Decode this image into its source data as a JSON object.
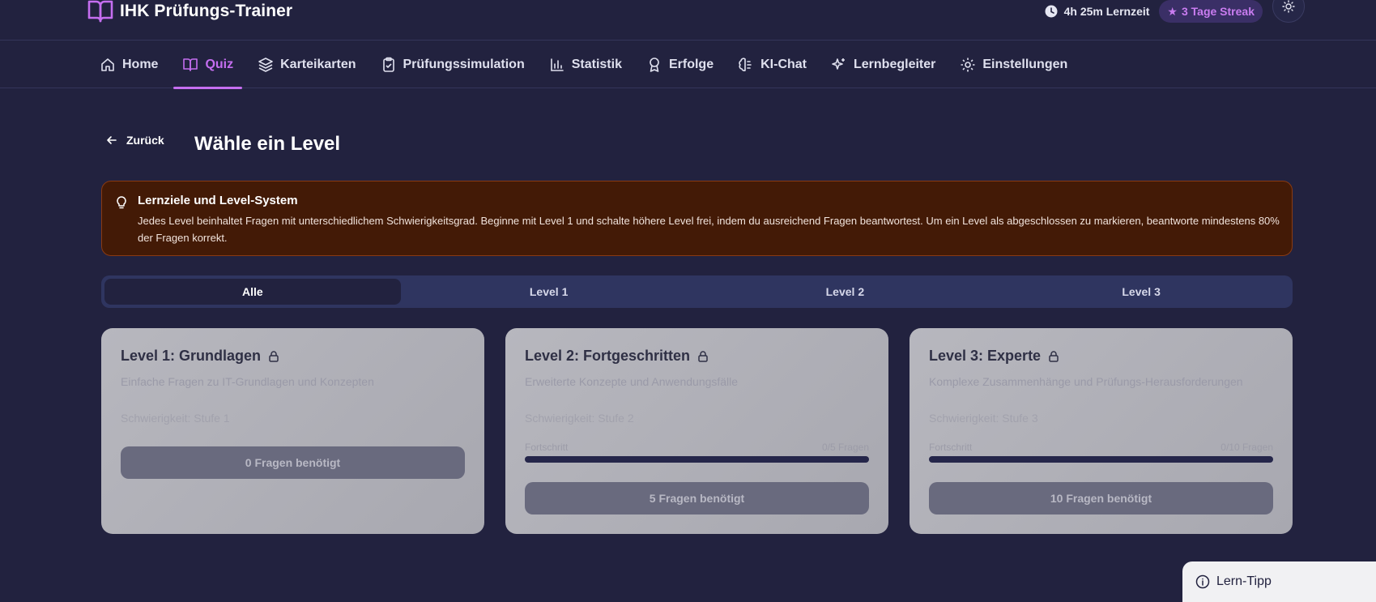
{
  "app": {
    "title": "IHK Prüfungs-Trainer",
    "learning_time": "4h 25m Lernzeit",
    "streak": "3 Tage Streak",
    "accent": "#c56ef0"
  },
  "nav": {
    "items": [
      {
        "label": "Home",
        "icon": "home-icon"
      },
      {
        "label": "Quiz",
        "icon": "book-open-icon",
        "active": true
      },
      {
        "label": "Karteikarten",
        "icon": "layers-icon"
      },
      {
        "label": "Prüfungssimulation",
        "icon": "clipboard-check-icon"
      },
      {
        "label": "Statistik",
        "icon": "bar-chart-icon"
      },
      {
        "label": "Erfolge",
        "icon": "award-icon"
      },
      {
        "label": "KI-Chat",
        "icon": "brain-icon"
      },
      {
        "label": "Lernbegleiter",
        "icon": "sparkles-icon"
      },
      {
        "label": "Einstellungen",
        "icon": "settings-icon"
      }
    ]
  },
  "page": {
    "back_label": "Zurück",
    "title": "Wähle ein Level"
  },
  "banner": {
    "title": "Lernziele und Level-System",
    "text": "Jedes Level beinhaltet Fragen mit unterschiedlichem Schwierigkeitsgrad. Beginne mit Level 1 und schalte höhere Level frei, indem du ausreichend Fragen beantwortest. Um ein Level als abgeschlossen zu markieren, beantworte mindestens 80% der Fragen korrekt.",
    "background": "#431a06"
  },
  "tabs": [
    {
      "label": "Alle",
      "active": true
    },
    {
      "label": "Level 1"
    },
    {
      "label": "Level 2"
    },
    {
      "label": "Level 3"
    }
  ],
  "levels": [
    {
      "title": "Level 1: Grundlagen",
      "description": "Einfache Fragen zu IT-Grundlagen und Konzepten",
      "difficulty": "Schwierigkeit: Stufe 1",
      "button": "0 Fragen benötigt"
    },
    {
      "title": "Level 2: Fortgeschritten",
      "description": "Erweiterte Konzepte und Anwendungsfälle",
      "difficulty": "Schwierigkeit: Stufe 2",
      "progress_label": "Fortschritt",
      "progress_value": "0/5 Fragen",
      "progress": 0,
      "button": "5 Fragen benötigt"
    },
    {
      "title": "Level 3: Experte",
      "description": "Komplexe Zusammenhänge und Prüfungs-Herausforderungen",
      "difficulty": "Schwierigkeit: Stufe 3",
      "progress_label": "Fortschritt",
      "progress_value": "0/10 Fragen",
      "progress": 0,
      "button": "10 Fragen benötigt"
    }
  ],
  "tip": {
    "label": "Lern-Tipp"
  }
}
